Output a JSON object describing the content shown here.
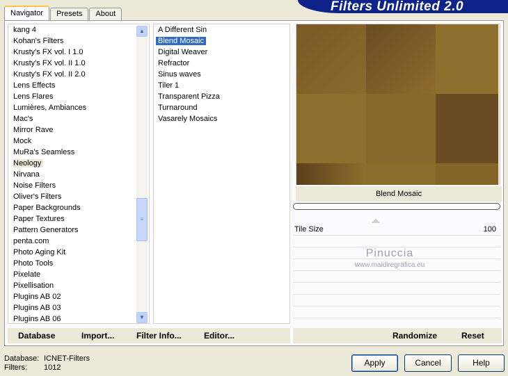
{
  "tabs": [
    {
      "label": "Navigator",
      "active": true
    },
    {
      "label": "Presets",
      "active": false
    },
    {
      "label": "About",
      "active": false
    }
  ],
  "banner": {
    "title": "Filters Unlimited 2.0",
    "bg_color": "#0d2389"
  },
  "categories": {
    "items": [
      "kang 4",
      "Kohan's Filters",
      "Krusty's FX vol. I 1.0",
      "Krusty's FX vol. II 1.0",
      "Krusty's FX vol. II 2.0",
      "Lens Effects",
      "Lens Flares",
      "Lumières, Ambiances",
      "Mac's",
      "Mirror Rave",
      "Mock",
      "MuRa's Seamless",
      "Neology",
      "Nirvana",
      "Noise Filters",
      "Oliver's Filters",
      "Paper Backgrounds",
      "Paper Textures",
      "Pattern Generators",
      "penta.com",
      "Photo Aging Kit",
      "Photo Tools",
      "Pixelate",
      "Pixellisation",
      "Plugins AB 02",
      "Plugins AB 03",
      "Plugins AB 06"
    ],
    "selected": "Neology"
  },
  "filters": {
    "items": [
      "A Different Sin",
      "Blend Mosaic",
      "Digital Weaver",
      "Refractor",
      "Sinus waves",
      "Tiler 1",
      "Transparent Pizza",
      "Turnaround",
      "Vasarely Mosaics"
    ],
    "selected": "Blend Mosaic",
    "selection_color": "#316ac5"
  },
  "preview": {
    "filter_name": "Blend Mosaic"
  },
  "params": [
    {
      "label": "Tile Size",
      "value": "100"
    }
  ],
  "watermark": {
    "name": "Pinuccia",
    "url": "www.maidiregrafica.eu"
  },
  "list_buttons": {
    "database": "Database",
    "import": "Import...",
    "filter_info": "Filter Info...",
    "editor": "Editor..."
  },
  "preview_buttons": {
    "randomize": "Randomize",
    "reset": "Reset"
  },
  "status": {
    "database_label": "Database:",
    "database_value": "ICNET-Filters",
    "filters_label": "Filters:",
    "filters_value": "1012"
  },
  "dialog_buttons": {
    "apply": "Apply",
    "cancel": "Cancel",
    "help": "Help"
  }
}
